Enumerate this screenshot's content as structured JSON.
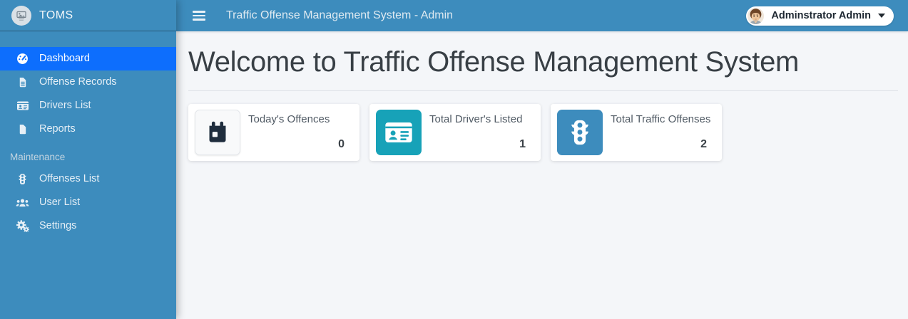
{
  "brand": {
    "name": "TOMS",
    "logo_icon": "broken-image-icon"
  },
  "topbar": {
    "menu_icon": "hamburger-icon",
    "title": "Traffic Offense Management System - Admin",
    "user": {
      "name": "Adminstrator Admin",
      "avatar_icon": "male-avatar-icon",
      "caret_icon": "caret-down-icon"
    }
  },
  "sidebar": {
    "items": [
      {
        "label": "Dashboard",
        "icon": "gauge-icon",
        "active": true
      },
      {
        "label": "Offense Records",
        "icon": "file-lines-icon",
        "active": false
      },
      {
        "label": "Drivers List",
        "icon": "id-card-icon",
        "active": false
      },
      {
        "label": "Reports",
        "icon": "file-icon",
        "active": false
      }
    ],
    "section_label": "Maintenance",
    "maintenance_items": [
      {
        "label": "Offenses List",
        "icon": "traffic-light-icon",
        "active": false
      },
      {
        "label": "User List",
        "icon": "users-icon",
        "active": false
      },
      {
        "label": "Settings",
        "icon": "gears-icon",
        "active": false
      }
    ]
  },
  "main": {
    "heading": "Welcome to Traffic Offense Management System",
    "cards": [
      {
        "label": "Today's Offences",
        "value": "0",
        "icon": "calendar-day-icon",
        "icon_style": "light"
      },
      {
        "label": "Total Driver's Listed",
        "value": "1",
        "icon": "id-card-icon",
        "icon_style": "teal"
      },
      {
        "label": "Total Traffic Offenses",
        "value": "2",
        "icon": "traffic-light-icon",
        "icon_style": "blue"
      }
    ]
  },
  "colors": {
    "sidebar_blue": "#3d8cbd",
    "active_item_blue": "#0d6efd",
    "teal_accent": "#17a2b8",
    "content_background": "#f4f6f9",
    "calendar_icon_navy": "#1f2d3d"
  }
}
